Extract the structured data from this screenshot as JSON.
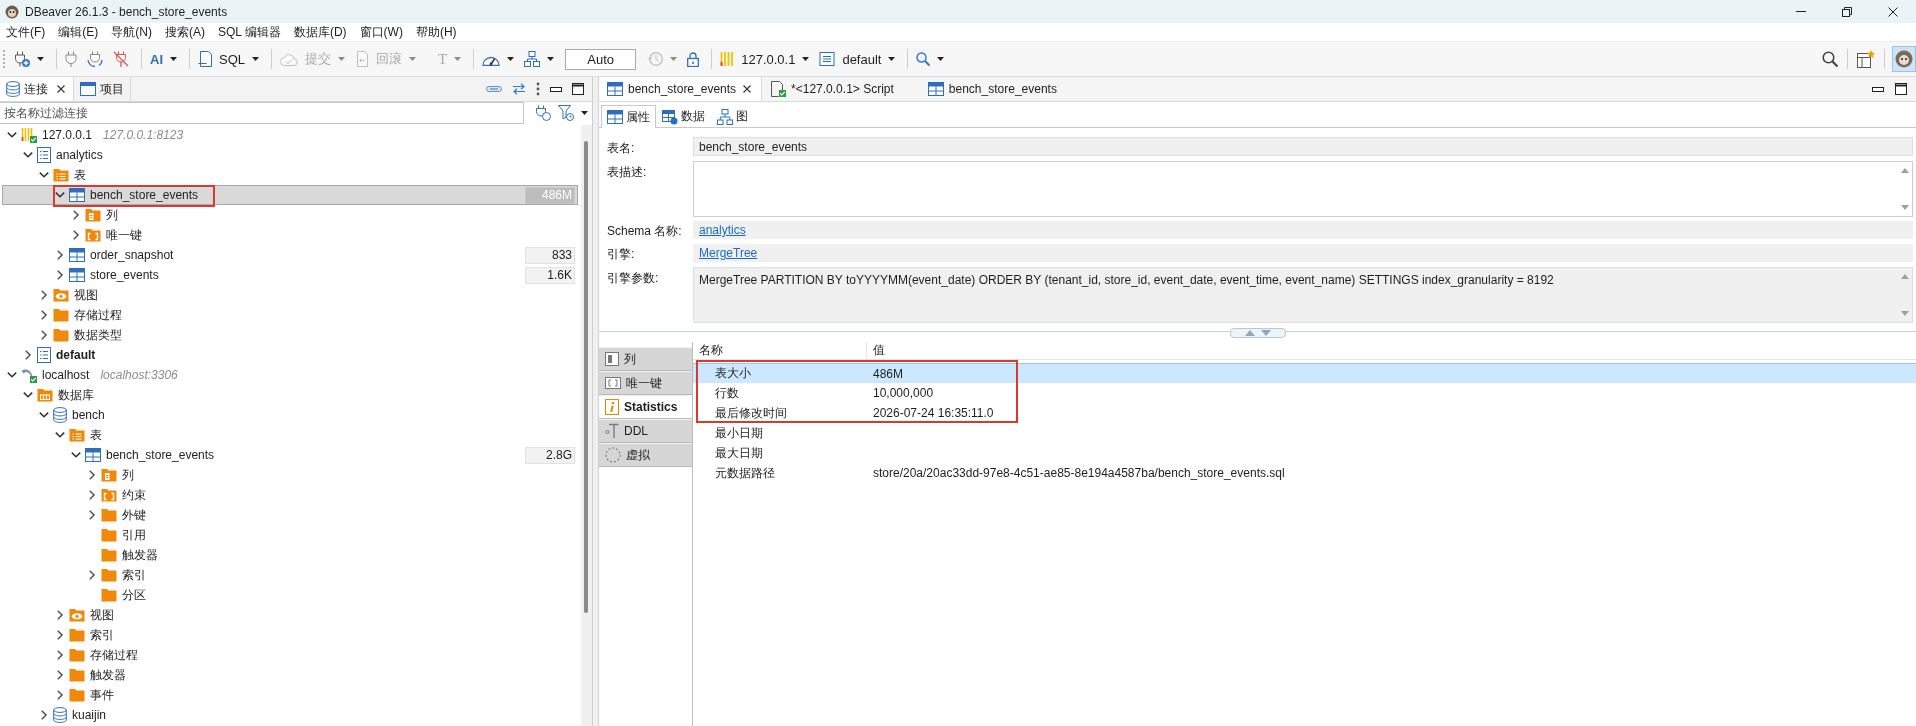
{
  "window": {
    "title": "DBeaver 26.1.3 - bench_store_events"
  },
  "menu_bar": [
    "文件(F)",
    "编辑(E)",
    "导航(N)",
    "搜索(A)",
    "SQL 编辑器",
    "数据库(D)",
    "窗口(W)",
    "帮助(H)"
  ],
  "toolbar": {
    "groups": [
      [
        {
          "kind": "new-connection",
          "dropdown": true,
          "disabled": false
        }
      ],
      [
        {
          "kind": "connect",
          "dropdown": false,
          "disabled": false
        },
        {
          "kind": "reconnect",
          "dropdown": false,
          "disabled": false
        },
        {
          "kind": "disconnect",
          "dropdown": false,
          "disabled": false
        }
      ],
      [
        {
          "kind": "ai",
          "label": "AI",
          "dropdown": true,
          "disabled": false
        }
      ],
      [
        {
          "kind": "sql-editor",
          "label": "SQL",
          "dropdown": true,
          "disabled": false
        }
      ],
      [
        {
          "kind": "commit",
          "label": "提交",
          "dropdown": true,
          "disabled": true
        },
        {
          "kind": "rollback",
          "label": "回滚",
          "dropdown": true,
          "disabled": true
        },
        {
          "kind": "transaction-mode",
          "label": "T",
          "dropdown": true,
          "disabled": true
        }
      ],
      [
        {
          "kind": "dashboard",
          "dropdown": true,
          "disabled": false
        },
        {
          "kind": "network",
          "dropdown": true,
          "disabled": false
        },
        {
          "kind": "mode-field",
          "value": "Auto"
        },
        {
          "kind": "history",
          "dropdown": true,
          "disabled": true
        },
        {
          "kind": "lock",
          "dropdown": false,
          "disabled": false
        }
      ],
      [
        {
          "kind": "active-connection",
          "label": "127.0.0.1",
          "dropdown": true,
          "disabled": false
        },
        {
          "kind": "active-schema",
          "label": "default",
          "dropdown": true,
          "disabled": false
        }
      ],
      [
        {
          "kind": "search",
          "dropdown": true,
          "disabled": false
        }
      ]
    ],
    "right": [
      {
        "kind": "global-search",
        "selected": false
      },
      {
        "kind": "perspective",
        "selected": false
      },
      {
        "kind": "avatar",
        "selected": true
      }
    ]
  },
  "navigator": {
    "tabs": [
      {
        "label": "连接",
        "kind": "connections",
        "selected": true,
        "closable": true
      },
      {
        "label": "项目",
        "kind": "projects",
        "selected": false,
        "closable": false
      }
    ],
    "filter": {
      "placeholder": "按名称过滤连接"
    },
    "tree": [
      {
        "label": "127.0.0.1",
        "kind": "bars-connection",
        "host": "127.0.0.1:8123",
        "expandable": true,
        "expanded": true,
        "selected": false,
        "outlined": false,
        "children": [
          {
            "label": "analytics",
            "kind": "schema",
            "bold": false,
            "expandable": true,
            "expanded": true,
            "selected": false,
            "outlined": false,
            "children": [
              {
                "label": "表",
                "kind": "tables-folder",
                "expandable": true,
                "expanded": true,
                "selected": false,
                "outlined": false,
                "children": [
                  {
                    "label": "bench_store_events",
                    "kind": "table",
                    "size": "486M",
                    "expandable": true,
                    "expanded": true,
                    "selected": true,
                    "outlined": true,
                    "children": [
                      {
                        "label": "列",
                        "kind": "columns-folder",
                        "expandable": true,
                        "expanded": false,
                        "selected": false,
                        "outlined": false
                      },
                      {
                        "label": "唯一键",
                        "kind": "keys-folder",
                        "expandable": true,
                        "expanded": false,
                        "selected": false,
                        "outlined": false
                      }
                    ]
                  },
                  {
                    "label": "order_snapshot",
                    "kind": "table",
                    "size": "833",
                    "expandable": true,
                    "expanded": false,
                    "selected": false,
                    "outlined": false
                  },
                  {
                    "label": "store_events",
                    "kind": "table",
                    "size": "1.6K",
                    "expandable": true,
                    "expanded": false,
                    "selected": false,
                    "outlined": false
                  }
                ]
              },
              {
                "label": "视图",
                "kind": "views-folder",
                "expandable": true,
                "expanded": false,
                "selected": false,
                "outlined": false
              },
              {
                "label": "存储过程",
                "kind": "folder",
                "expandable": true,
                "expanded": false,
                "selected": false,
                "outlined": false
              },
              {
                "label": "数据类型",
                "kind": "folder",
                "expandable": true,
                "expanded": false,
                "selected": false,
                "outlined": false
              }
            ]
          },
          {
            "label": "default",
            "kind": "schema",
            "bold": true,
            "expandable": true,
            "expanded": false,
            "selected": false,
            "outlined": false
          }
        ]
      },
      {
        "label": "localhost",
        "kind": "dolphin-connection",
        "host": "localhost:3306",
        "expandable": true,
        "expanded": true,
        "selected": false,
        "outlined": false,
        "children": [
          {
            "label": "数据库",
            "kind": "databases-folder",
            "expandable": true,
            "expanded": true,
            "selected": false,
            "outlined": false,
            "children": [
              {
                "label": "bench",
                "kind": "database",
                "expandable": true,
                "expanded": true,
                "selected": false,
                "outlined": false,
                "children": [
                  {
                    "label": "表",
                    "kind": "tables-folder",
                    "expandable": true,
                    "expanded": true,
                    "selected": false,
                    "outlined": false,
                    "children": [
                      {
                        "label": "bench_store_events",
                        "kind": "table",
                        "size": "2.8G",
                        "expandable": true,
                        "expanded": true,
                        "selected": false,
                        "outlined": false,
                        "children": [
                          {
                            "label": "列",
                            "kind": "columns-folder",
                            "expandable": true,
                            "expanded": false,
                            "selected": false,
                            "outlined": false
                          },
                          {
                            "label": "约束",
                            "kind": "keys-folder",
                            "expandable": true,
                            "expanded": false,
                            "selected": false,
                            "outlined": false
                          },
                          {
                            "label": "外键",
                            "kind": "folder",
                            "expandable": true,
                            "expanded": false,
                            "selected": false,
                            "outlined": false
                          },
                          {
                            "label": "引用",
                            "kind": "folder",
                            "expandable": false,
                            "selected": false,
                            "outlined": false
                          },
                          {
                            "label": "触发器",
                            "kind": "folder",
                            "expandable": false,
                            "selected": false,
                            "outlined": false
                          },
                          {
                            "label": "索引",
                            "kind": "folder",
                            "expandable": true,
                            "expanded": false,
                            "selected": false,
                            "outlined": false
                          },
                          {
                            "label": "分区",
                            "kind": "folder",
                            "expandable": false,
                            "selected": false,
                            "outlined": false
                          }
                        ]
                      }
                    ]
                  },
                  {
                    "label": "视图",
                    "kind": "views-folder",
                    "expandable": true,
                    "expanded": false,
                    "selected": false,
                    "outlined": false
                  },
                  {
                    "label": "索引",
                    "kind": "folder",
                    "expandable": true,
                    "expanded": false,
                    "selected": false,
                    "outlined": false
                  },
                  {
                    "label": "存储过程",
                    "kind": "folder",
                    "expandable": true,
                    "expanded": false,
                    "selected": false,
                    "outlined": false
                  },
                  {
                    "label": "触发器",
                    "kind": "folder",
                    "expandable": true,
                    "expanded": false,
                    "selected": false,
                    "outlined": false
                  },
                  {
                    "label": "事件",
                    "kind": "folder",
                    "expandable": true,
                    "expanded": false,
                    "selected": false,
                    "outlined": false
                  }
                ]
              },
              {
                "label": "kuaijin",
                "kind": "database",
                "expandable": true,
                "expanded": false,
                "selected": false,
                "outlined": false
              }
            ]
          }
        ]
      }
    ]
  },
  "editor": {
    "tabs": [
      {
        "label": "bench_store_events",
        "kind": "table",
        "selected": true,
        "closable": true
      },
      {
        "label": "*<127.0.0.1> Script",
        "kind": "script",
        "selected": false,
        "closable": false
      },
      {
        "label": "bench_store_events",
        "kind": "table",
        "selected": false,
        "closable": false
      }
    ],
    "subtabs": [
      {
        "label": "属性",
        "kind": "properties",
        "selected": true
      },
      {
        "label": "数据",
        "kind": "data",
        "selected": false
      },
      {
        "label": "图",
        "kind": "diagram",
        "selected": false
      }
    ],
    "properties": [
      {
        "label": "表名:",
        "kind": "field",
        "editable": false,
        "value": "bench_store_events"
      },
      {
        "label": "表描述:",
        "kind": "textarea",
        "editable": true
      },
      {
        "label": "Schema 名称:",
        "kind": "link",
        "editable": false,
        "value": "analytics"
      },
      {
        "label": "引擎:",
        "kind": "link",
        "editable": false,
        "value": "MergeTree"
      },
      {
        "label": "引擎参数:",
        "kind": "textarea",
        "editable": false,
        "value": "MergeTree PARTITION BY toYYYYMM(event_date) ORDER BY (tenant_id, store_id, event_date, event_time, event_name) SETTINGS index_granularity = 8192"
      }
    ],
    "detail_tabs": [
      {
        "label": "列",
        "kind": "columns",
        "selected": false
      },
      {
        "label": "唯一键",
        "kind": "keys",
        "selected": false
      },
      {
        "label": "Statistics",
        "kind": "statistics",
        "selected": true
      },
      {
        "label": "DDL",
        "kind": "ddl",
        "selected": false
      },
      {
        "label": "虚拟",
        "kind": "virtual",
        "selected": false
      }
    ],
    "statistics": {
      "columns": [
        "名称",
        "值"
      ],
      "rows": [
        {
          "name": "表大小",
          "value": "486M",
          "selected": true,
          "outlined": true
        },
        {
          "name": "行数",
          "value": "10,000,000",
          "selected": false,
          "outlined": true
        },
        {
          "name": "最后修改时间",
          "value": "2026-07-24 16:35:11.0",
          "selected": false,
          "outlined": true
        },
        {
          "name": "最小日期",
          "selected": false,
          "outlined": false
        },
        {
          "name": "最大日期",
          "selected": false,
          "outlined": false
        },
        {
          "name": "元数据路径",
          "value": "store/20a/20ac33dd-97e8-4c51-ae85-8e194a4587ba/bench_store_events.sql",
          "selected": false,
          "outlined": false
        }
      ]
    }
  }
}
